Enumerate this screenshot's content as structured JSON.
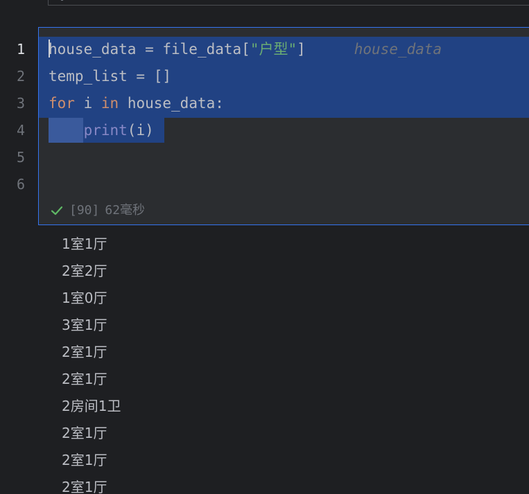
{
  "editor": {
    "line_numbers": [
      "1",
      "2",
      "3",
      "4",
      "5",
      "6"
    ],
    "code": {
      "line1": {
        "var": "house_data",
        "op": " = ",
        "call": "file_data[",
        "string": "\"户型\"",
        "close": "]",
        "inlay_hint": "house_data"
      },
      "line2": {
        "text": "temp_list = []"
      },
      "line3": {
        "kw_for": "for",
        "mid1": " i ",
        "kw_in": "in",
        "mid2": " house_data:"
      },
      "line4": {
        "indent": "    ",
        "builtin": "print",
        "args": "(i)"
      }
    },
    "execution": {
      "count": "[90]",
      "duration": "62毫秒"
    }
  },
  "output": {
    "lines": [
      "1室1厅",
      "2室2厅",
      "1室0厅",
      "3室1厅",
      "2室1厅",
      "2室1厅",
      "2房间1卫",
      "2室1厅",
      "2室1厅",
      "2室1厅"
    ]
  },
  "colors": {
    "background": "#1e1f22",
    "selection": "#214283",
    "active_border": "#3574f0",
    "keyword": "#cf8e6d",
    "string": "#6aab73",
    "builtin": "#8888c6",
    "success": "#5fb865"
  }
}
